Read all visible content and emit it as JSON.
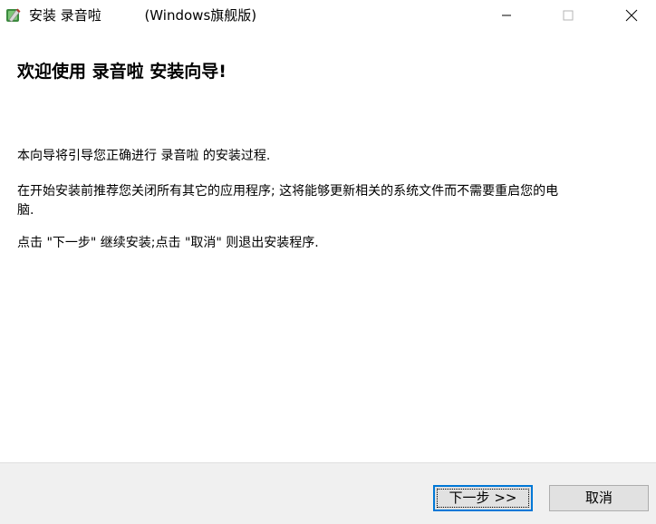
{
  "window": {
    "title": "安装 录音啦          (Windows旗舰版)",
    "icons": {
      "app": "installer-app-icon",
      "minimize": "minimize-icon",
      "maximize": "maximize-icon",
      "close": "close-icon"
    }
  },
  "content": {
    "heading": "欢迎使用 录音啦 安装向导!",
    "paragraph1": "本向导将引导您正确进行 录音啦 的安装过程.",
    "paragraph2": "在开始安装前推荐您关闭所有其它的应用程序; 这将能够更新相关的系统文件而不需要重启您的电脑.",
    "paragraph3": "点击 \"下一步\" 继续安装;点击 \"取消\" 则退出安装程序."
  },
  "footer": {
    "next_label": "下一步 >>",
    "cancel_label": "取消"
  },
  "colors": {
    "accent": "#0078d7",
    "footer_bg": "#f0f0f0",
    "button_bg": "#e1e1e1"
  }
}
